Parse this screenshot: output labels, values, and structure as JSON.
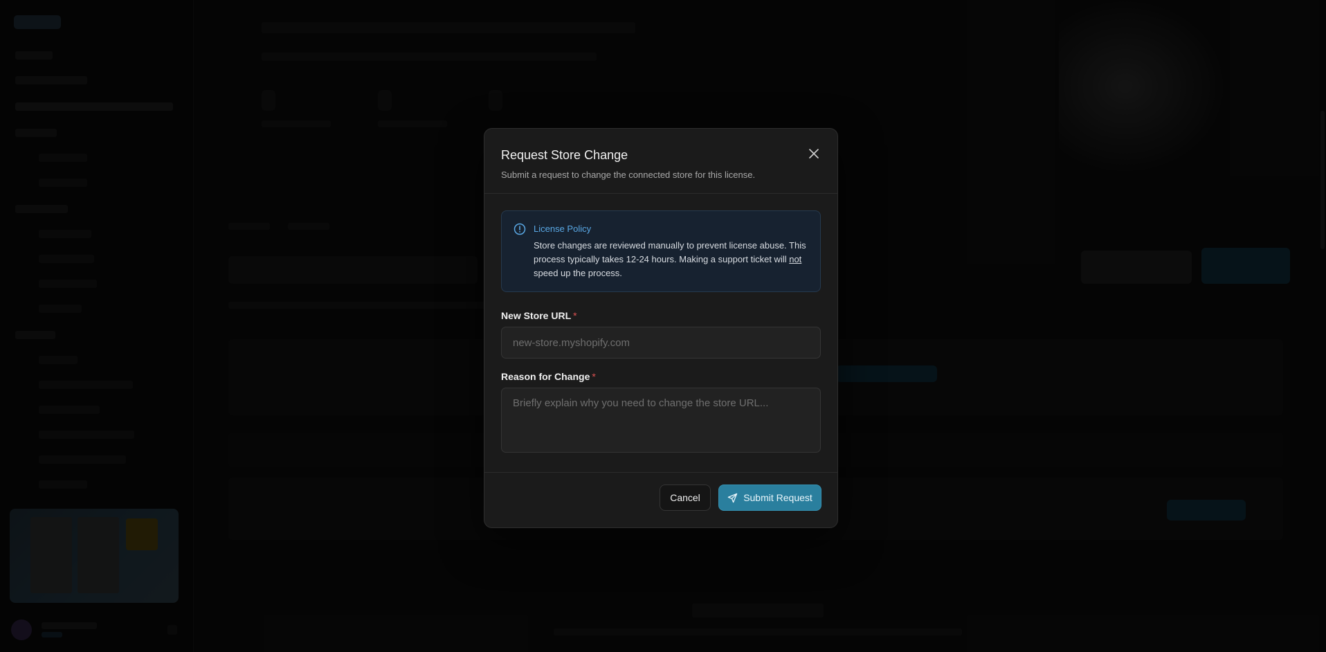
{
  "modal": {
    "title": "Request Store Change",
    "subtitle": "Submit a request to change the connected store for this license.",
    "close_icon": "close-icon",
    "policy": {
      "icon": "info-circle-icon",
      "title": "License Policy",
      "body_part1": "Store changes are reviewed manually to prevent license abuse. This process typically takes 12-24 hours. Making a support ticket will ",
      "body_emphasis": "not",
      "body_part2": " speed up the process."
    },
    "new_store_url": {
      "label": "New Store URL",
      "required_marker": "*",
      "value": "",
      "placeholder": "new-store.myshopify.com"
    },
    "reason": {
      "label": "Reason for Change",
      "required_marker": "*",
      "value": "",
      "placeholder": "Briefly explain why you need to change the store URL..."
    },
    "cancel_label": "Cancel",
    "submit_label": "Submit Request",
    "submit_icon": "send-icon"
  },
  "colors": {
    "accent": "#2a7f9e",
    "info": "#5aa9e6",
    "required": "#e05252"
  }
}
